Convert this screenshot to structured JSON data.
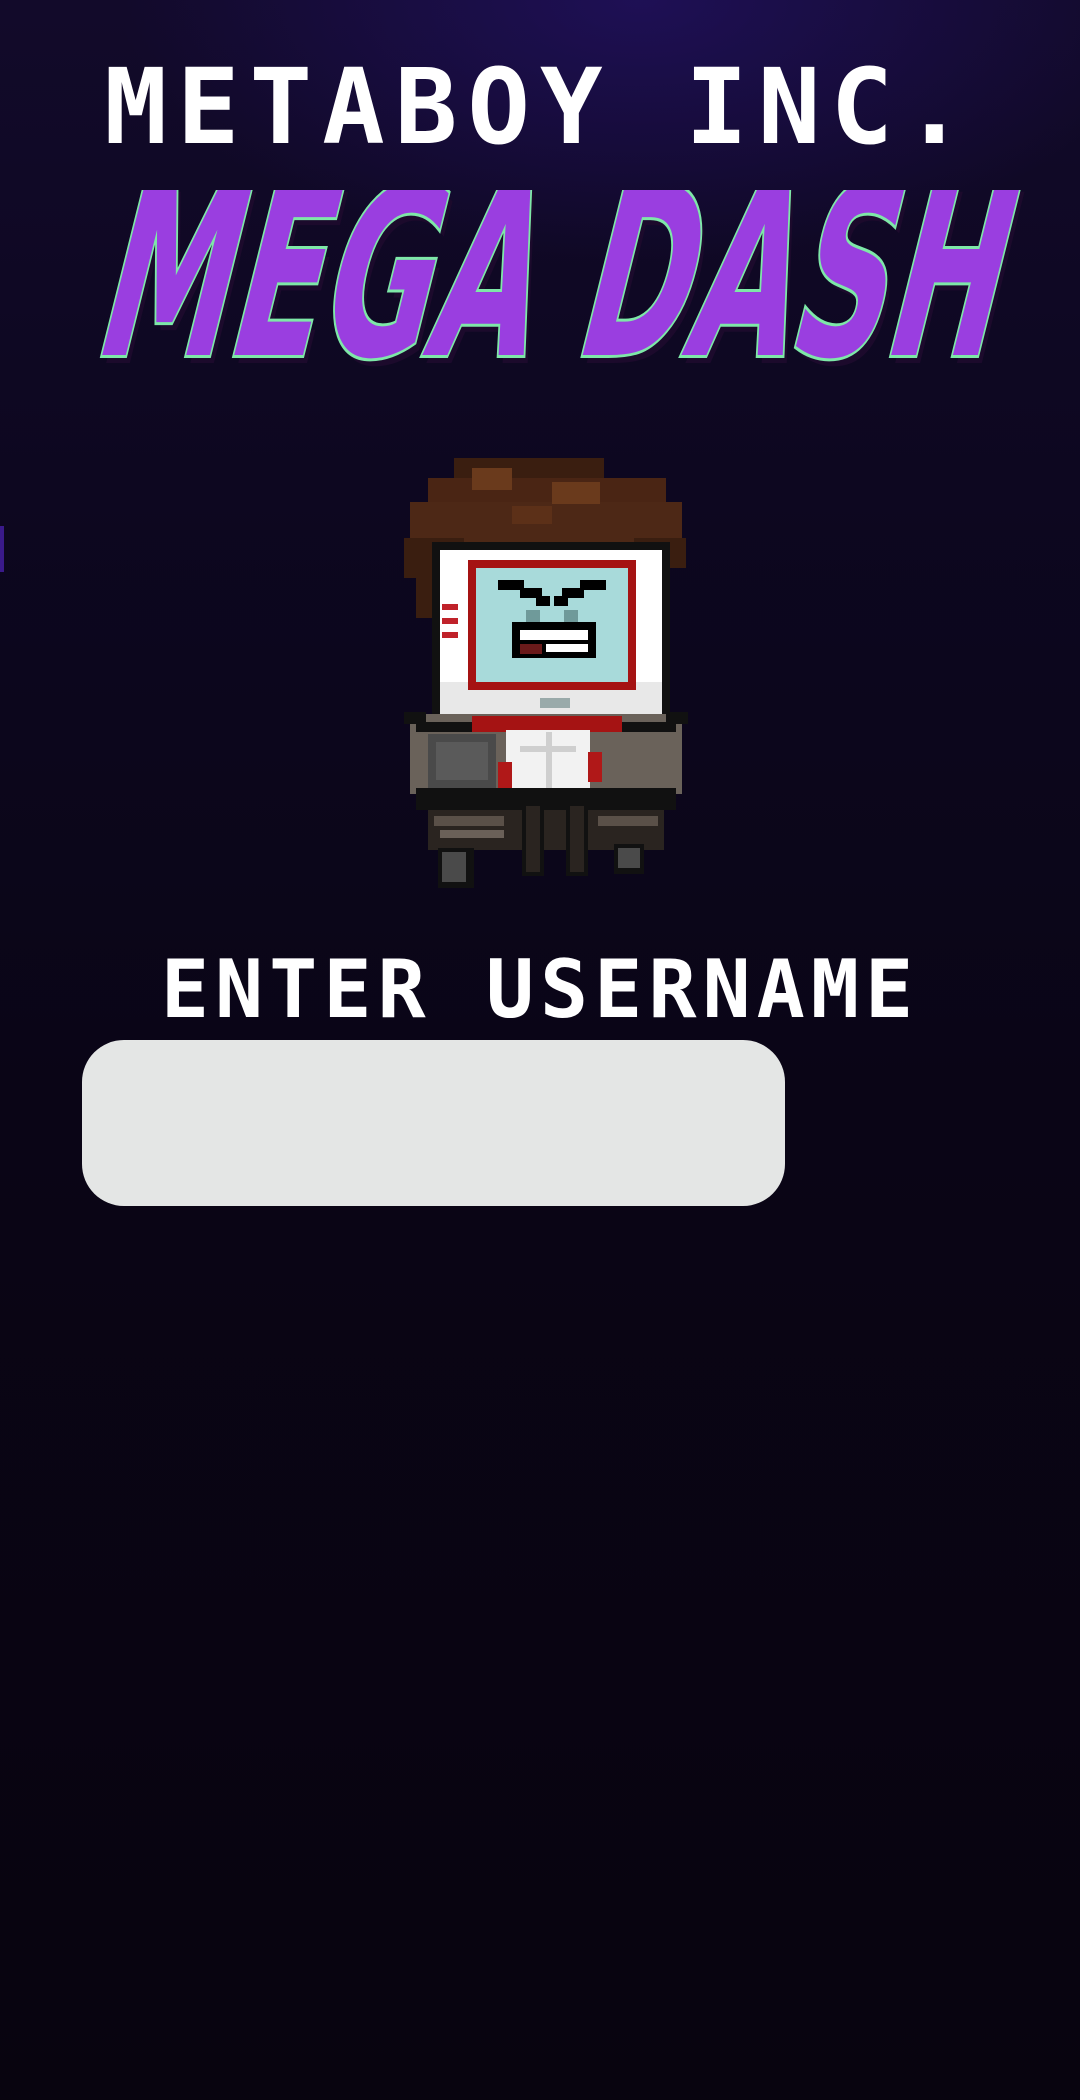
{
  "header": {
    "company": "METABOY INC.",
    "game_title": "MEGA DASH"
  },
  "hero": {
    "character": "metaboy-character"
  },
  "login": {
    "label": "ENTER USERNAME",
    "username_value": "",
    "username_placeholder": ""
  },
  "colors": {
    "background": "#0a0512",
    "title_fill": "#9a3ee0",
    "title_outline": "#7ee8a8",
    "text": "#ffffff",
    "input_bg": "#e4e6e5"
  }
}
